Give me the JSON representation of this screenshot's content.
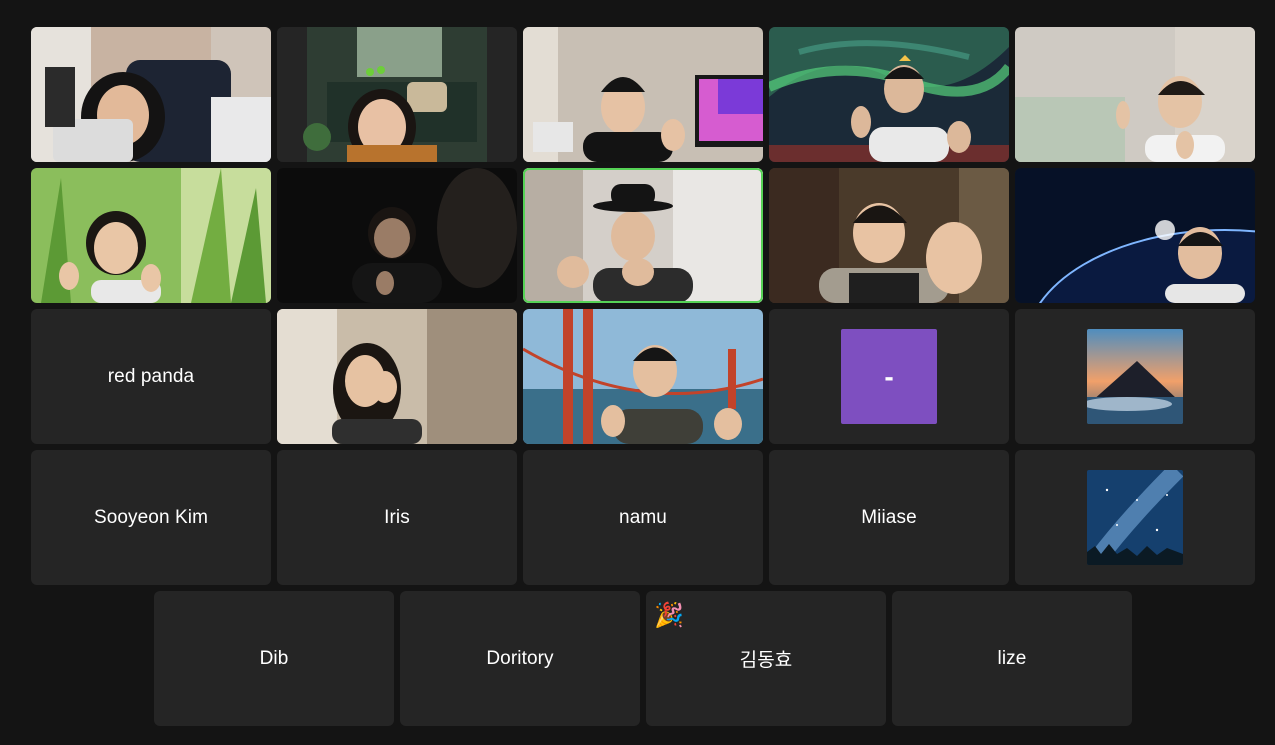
{
  "participants": {
    "red_panda": {
      "name": "red panda"
    },
    "sooyeon": {
      "name": "Sooyeon Kim"
    },
    "iris": {
      "name": "Iris"
    },
    "namu": {
      "name": "namu"
    },
    "miiase": {
      "name": "Miiase"
    },
    "dib": {
      "name": "Dib"
    },
    "doritory": {
      "name": "Doritory"
    },
    "kim": {
      "name": "김동효",
      "reaction": "🎉"
    },
    "lize": {
      "name": "lize"
    },
    "dash": {
      "avatar_text": "-",
      "avatar_color": "#7e4fc0"
    }
  },
  "speaking_color": "#56d256"
}
